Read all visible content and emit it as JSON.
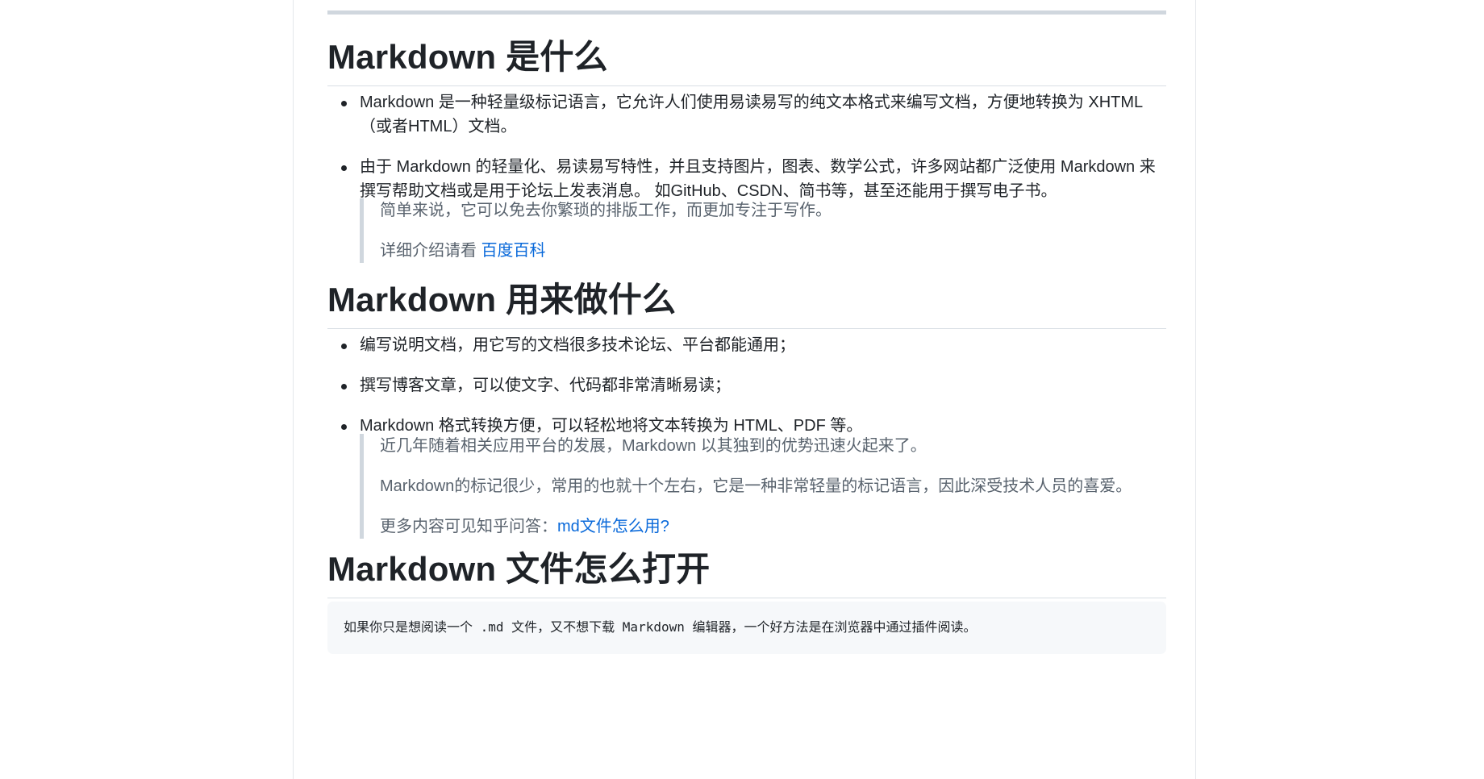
{
  "sections": [
    {
      "heading": "Markdown 是什么",
      "items": [
        "Markdown 是一种轻量级标记语言，它允许人们使用易读易写的纯文本格式来编写文档，方便地转换为 XHTML （或者HTML）文档。",
        "由于 Markdown 的轻量化、易读易写特性，并且支持图片，图表、数学公式，许多网站都广泛使用 Markdown 来撰写帮助文档或是用于论坛上发表消息。 如GitHub、CSDN、简书等，甚至还能用于撰写电子书。"
      ],
      "quote": {
        "line1": "简单来说，它可以免去你繁琐的排版工作，而更加专注于写作。",
        "line2_prefix": "详细介绍请看 ",
        "line2_link": "百度百科"
      }
    },
    {
      "heading": "Markdown 用来做什么",
      "items": [
        "编写说明文档，用它写的文档很多技术论坛、平台都能通用；",
        "撰写博客文章，可以使文字、代码都非常清晰易读；",
        "Markdown 格式转换方便，可以轻松地将文本转换为 HTML、PDF 等。"
      ],
      "quote": {
        "line1": "近几年随着相关应用平台的发展，Markdown 以其独到的优势迅速火起来了。",
        "line2": "Markdown的标记很少，常用的也就十个左右，它是一种非常轻量的标记语言，因此深受技术人员的喜爱。",
        "line3_prefix": "更多内容可见知乎问答：",
        "line3_link": "md文件怎么用?"
      }
    },
    {
      "heading": "Markdown 文件怎么打开",
      "code": "如果你只是想阅读一个 .md 文件，又不想下载 Markdown 编辑器，一个好方法是在浏览器中通过插件阅读。"
    }
  ]
}
